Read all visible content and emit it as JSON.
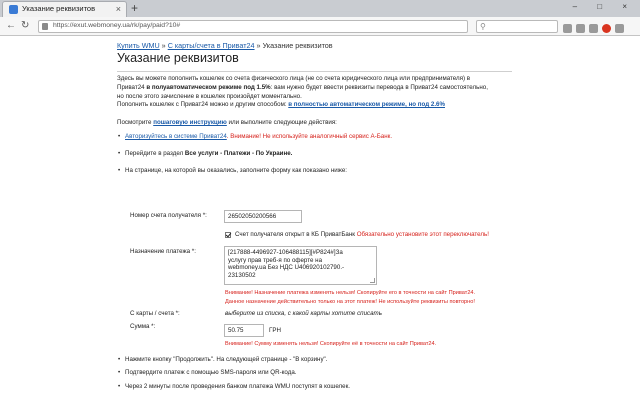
{
  "browser": {
    "tab_title": "Указание реквизитов",
    "tab_close": "×",
    "new_tab": "+",
    "window_buttons": "– □ ×",
    "url": "https://exut.webmoney.ua/rk/pay/paid?10#",
    "search_placeholder": ""
  },
  "breadcrumb": {
    "item1": "Купить WMU",
    "sep": " » ",
    "item2": "С карты/счета в Приват24",
    "item3": "Указание реквизитов"
  },
  "page_title": "Указание реквизитов",
  "intro": {
    "line1": "Здесь вы можете пополнить кошелек со счета физического лица (не со счета юридического лица или предпринимателя) в",
    "line2a": "Приват24 ",
    "line2b": "в полуавтоматическом режиме под 1.5%",
    "line2c": ": вам нужно будет ввести реквизиты перевода в Приват24 самостоятельно,",
    "line3": "но после этого зачисление в кошелек произойдет моментально.",
    "line4a": "Пополнить кошелек с Приват24 можно и другим способом: ",
    "line4b": "в полностью автоматическом режиме, но под 2.6%"
  },
  "see_line": {
    "prefix": "Посмотрите ",
    "link": "пошаговую инструкцию",
    "suffix": " или выполните следующие действия:"
  },
  "steps": {
    "s1_link": "Авторизуйтесь в системе Приват24",
    "s1_warn": ". Внимание! Не используйте аналогичный сервис А-Банк.",
    "s2_prefix": "Перейдите в раздел ",
    "s2_bold": "Все услуги - Платежи - По Украине.",
    "s3": "На странице, на которой вы оказались, заполните форму как показано ниже:"
  },
  "form": {
    "account_label": "Номер счета получателя *:",
    "account_value": "26502050200566",
    "checkbox_text": "Счет получателя открыт в КБ ПриватБанк",
    "checkbox_warn": " Обязательно установите этот переключатель!",
    "purpose_label": "Назначение платежа *:",
    "purpose_line1": "[217888-4496927-106488115][#P824#]За",
    "purpose_line2": "услугу прав треб-я по оферте на",
    "purpose_line3": "webmoney.ua Без НДС U406920102790.-",
    "purpose_line4": "23130502",
    "purpose_warn1": "Внимание! Назначение платежа изменять нельзя! Скопируйте его в точности на сайт Приват24.",
    "purpose_warn2": "Данное назначение действительно только на этот платеж! Не используйте реквизиты повторно!",
    "card_label": "С карты / счета *:",
    "card_hint": "выберите из списка, с какой карты хотите списать",
    "sum_label": "Сумма *:",
    "sum_value": "50.75",
    "sum_currency": "ГРН",
    "sum_warn": "Внимание! Сумму изменять нельзя! Скопируйте её в точности на сайт Приват24."
  },
  "bottom_steps": {
    "b1": "Нажмите кнопку \"Продолжить\". На следующей странице - \"В корзину\".",
    "b2": "Подтвердите платеж с помощью SMS-пароля или QR-кода.",
    "b3": "Через 2 минуты после проведения банком платежа WMU поступят в кошелек."
  }
}
